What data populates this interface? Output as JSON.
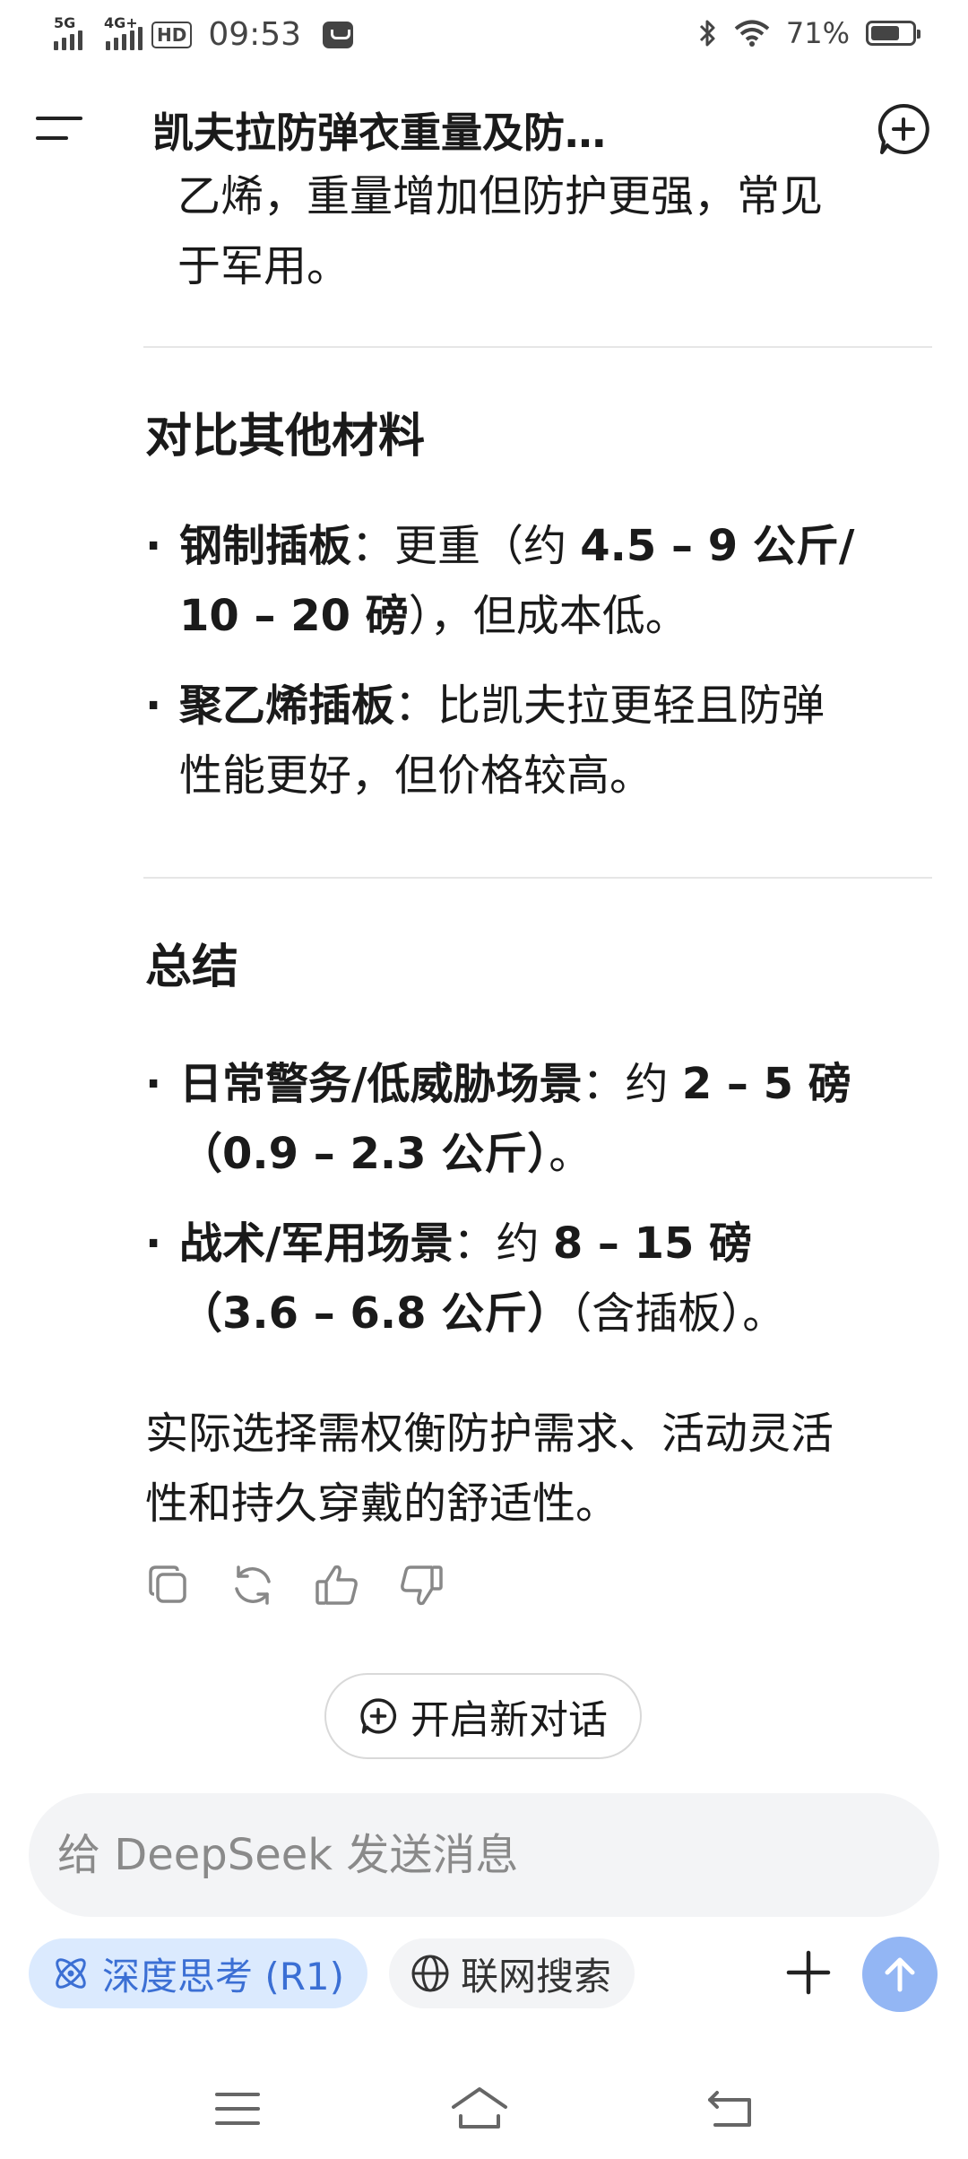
{
  "status_bar": {
    "signal_1": "5G",
    "signal_2": "4G+",
    "hd": "HD",
    "time": "09:53",
    "battery": "71%",
    "battery_level": 0.71
  },
  "header": {
    "title": "凯夫拉防弹衣重量及防…",
    "menu_icon": "menu-icon",
    "new_chat_icon": "add-chat-icon"
  },
  "content": {
    "continuation": [
      "乙烯，重量增加但防护更强，常见",
      "于军用。"
    ],
    "section1": {
      "heading": "对比其他材料",
      "items": [
        {
          "bold": "钢制插板",
          "text_parts": [
            "：更重（约 ",
            "4.5 – 9 公斤/",
            "10 – 20 磅",
            "），但成本低。"
          ]
        },
        {
          "bold": "聚乙烯插板",
          "text_parts": [
            "：比凯夫拉更轻且防弹",
            "性能更好，但价格较高。"
          ]
        }
      ]
    },
    "section2": {
      "heading": "总结",
      "items": [
        {
          "bold": "日常警务/低威胁场景",
          "text_parts": [
            "：约 ",
            "2 – 5 磅",
            "（0.9 – 2.3 公斤）",
            "。"
          ]
        },
        {
          "bold": "战术/军用场景",
          "text_parts": [
            "：约 ",
            "8 – 15 磅",
            "（3.6 – 6.8 公斤）",
            "（含插板）。"
          ]
        }
      ]
    },
    "conclusion": [
      "实际选择需权衡防护需求、活动灵活",
      "性和持久穿戴的舒适性。"
    ]
  },
  "actions": {
    "icons": [
      "copy-icon",
      "regenerate-icon",
      "thumbs-up-icon",
      "thumbs-down-icon"
    ],
    "new_dialog_label": "开启新对话"
  },
  "composer": {
    "placeholder": "给 DeepSeek 发送消息",
    "deep_think_label": "深度思考 (R1)",
    "web_search_label": "联网搜索",
    "accent_color": "#3b6fd4",
    "send_color": "#93b6f4"
  },
  "navbar": {
    "icons": [
      "recent-apps-icon",
      "home-icon",
      "back-icon"
    ]
  }
}
